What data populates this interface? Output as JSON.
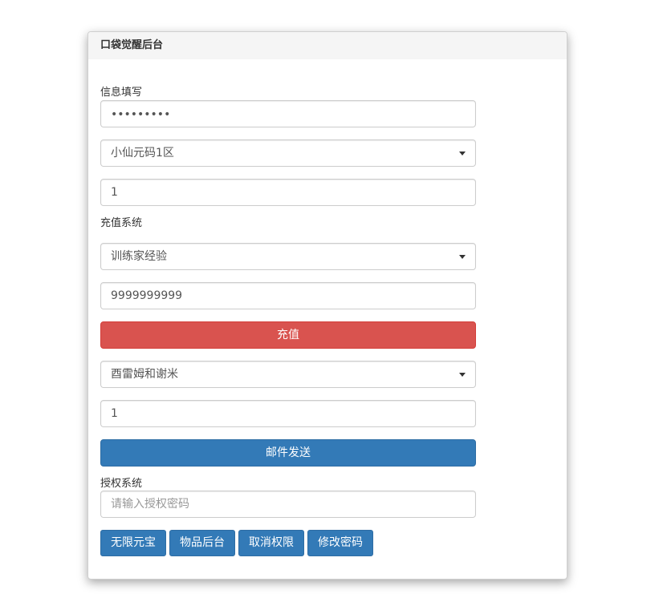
{
  "panel": {
    "title": "口袋觉醒后台"
  },
  "info_section": {
    "label": "信息填写",
    "password_value": "•••••••••",
    "server_select": "小仙元码1区",
    "quantity_value": "1"
  },
  "recharge_section": {
    "label": "充值系统",
    "type_select": "训练家经验",
    "amount_value": "9999999999",
    "recharge_button": "充值",
    "item_select": "酉雷姆和谢米",
    "item_quantity_value": "1",
    "mail_button": "邮件发送"
  },
  "auth_section": {
    "label": "授权系统",
    "password_placeholder": "请输入授权密码",
    "buttons": [
      {
        "label": "无限元宝"
      },
      {
        "label": "物品后台"
      },
      {
        "label": "取消权限"
      },
      {
        "label": "修改密码"
      }
    ]
  },
  "colors": {
    "danger": "#d9534f",
    "primary": "#337ab7",
    "heading_bg": "#f5f5f5"
  }
}
